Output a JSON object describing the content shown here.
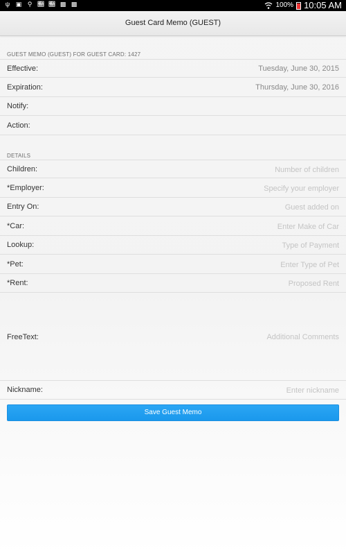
{
  "status_bar": {
    "icons": [
      "usb-icon",
      "image-icon",
      "key-icon",
      "news-icon",
      "news-icon",
      "briefcase-icon",
      "briefcase-icon"
    ],
    "wifi_icon": "wifi-icon",
    "battery_percent": "100%",
    "battery_icon": "battery-icon",
    "time": "10:05 AM"
  },
  "header": {
    "title": "Guest Card Memo (GUEST)"
  },
  "memo_section": {
    "label": "GUEST MEMO (GUEST) FOR GUEST CARD: 1427",
    "rows": [
      {
        "label": "Effective:",
        "value": "Tuesday, June 30, 2015"
      },
      {
        "label": "Expiration:",
        "value": "Thursday, June 30, 2016"
      },
      {
        "label": "Notify:",
        "value": ""
      },
      {
        "label": "Action:",
        "value": ""
      }
    ]
  },
  "details_section": {
    "label": "DETAILS",
    "rows": [
      {
        "label": "Children:",
        "placeholder": "Number of children"
      },
      {
        "label": "*Employer:",
        "placeholder": "Specify your employer"
      },
      {
        "label": "Entry On:",
        "placeholder": "Guest added on"
      },
      {
        "label": "*Car:",
        "placeholder": "Enter Make of Car"
      },
      {
        "label": "Lookup:",
        "placeholder": "Type of Payment"
      },
      {
        "label": "*Pet:",
        "placeholder": "Enter Type of Pet"
      },
      {
        "label": "*Rent:",
        "placeholder": "Proposed Rent"
      }
    ],
    "freetext": {
      "label": "FreeText:",
      "placeholder": "Additional Comments"
    },
    "nickname": {
      "label": "Nickname:",
      "placeholder": "Enter nickname"
    }
  },
  "save_button": {
    "label": "Save Guest Memo",
    "color": "#1da1f2"
  }
}
